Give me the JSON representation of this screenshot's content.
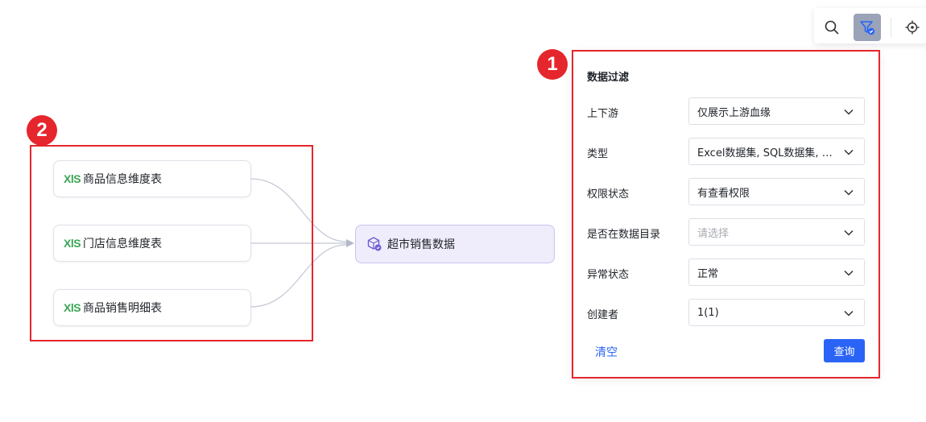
{
  "toolbar": {
    "buttons": [
      {
        "icon": "search-icon"
      },
      {
        "icon": "filter-icon",
        "active": true
      },
      {
        "icon": "locate-icon"
      }
    ]
  },
  "callouts": [
    {
      "number": "1"
    },
    {
      "number": "2"
    }
  ],
  "lineage": {
    "sources": [
      {
        "label": "商品信息维度表",
        "icon": "XlS"
      },
      {
        "label": "门店信息维度表",
        "icon": "XlS"
      },
      {
        "label": "商品销售明细表",
        "icon": "XlS"
      }
    ],
    "target": {
      "label": "超市销售数据",
      "icon": "dataset-icon"
    }
  },
  "filter_panel": {
    "title": "数据过滤",
    "fields": [
      {
        "label": "上下游",
        "value": "仅展示上游血缘",
        "placeholder": ""
      },
      {
        "label": "类型",
        "value": "Excel数据集, SQL数据集, 自助数据集",
        "placeholder": ""
      },
      {
        "label": "权限状态",
        "value": "有查看权限",
        "placeholder": ""
      },
      {
        "label": "是否在数据目录",
        "value": "",
        "placeholder": "请选择"
      },
      {
        "label": "异常状态",
        "value": "正常",
        "placeholder": ""
      },
      {
        "label": "创建者",
        "value": "1(1)",
        "placeholder": ""
      }
    ],
    "clear_label": "清空",
    "query_label": "查询"
  },
  "colors": {
    "accent": "#2a64f6",
    "callout": "#e5262c",
    "xls_green": "#3aa655",
    "target_bg": "#efedfb"
  }
}
